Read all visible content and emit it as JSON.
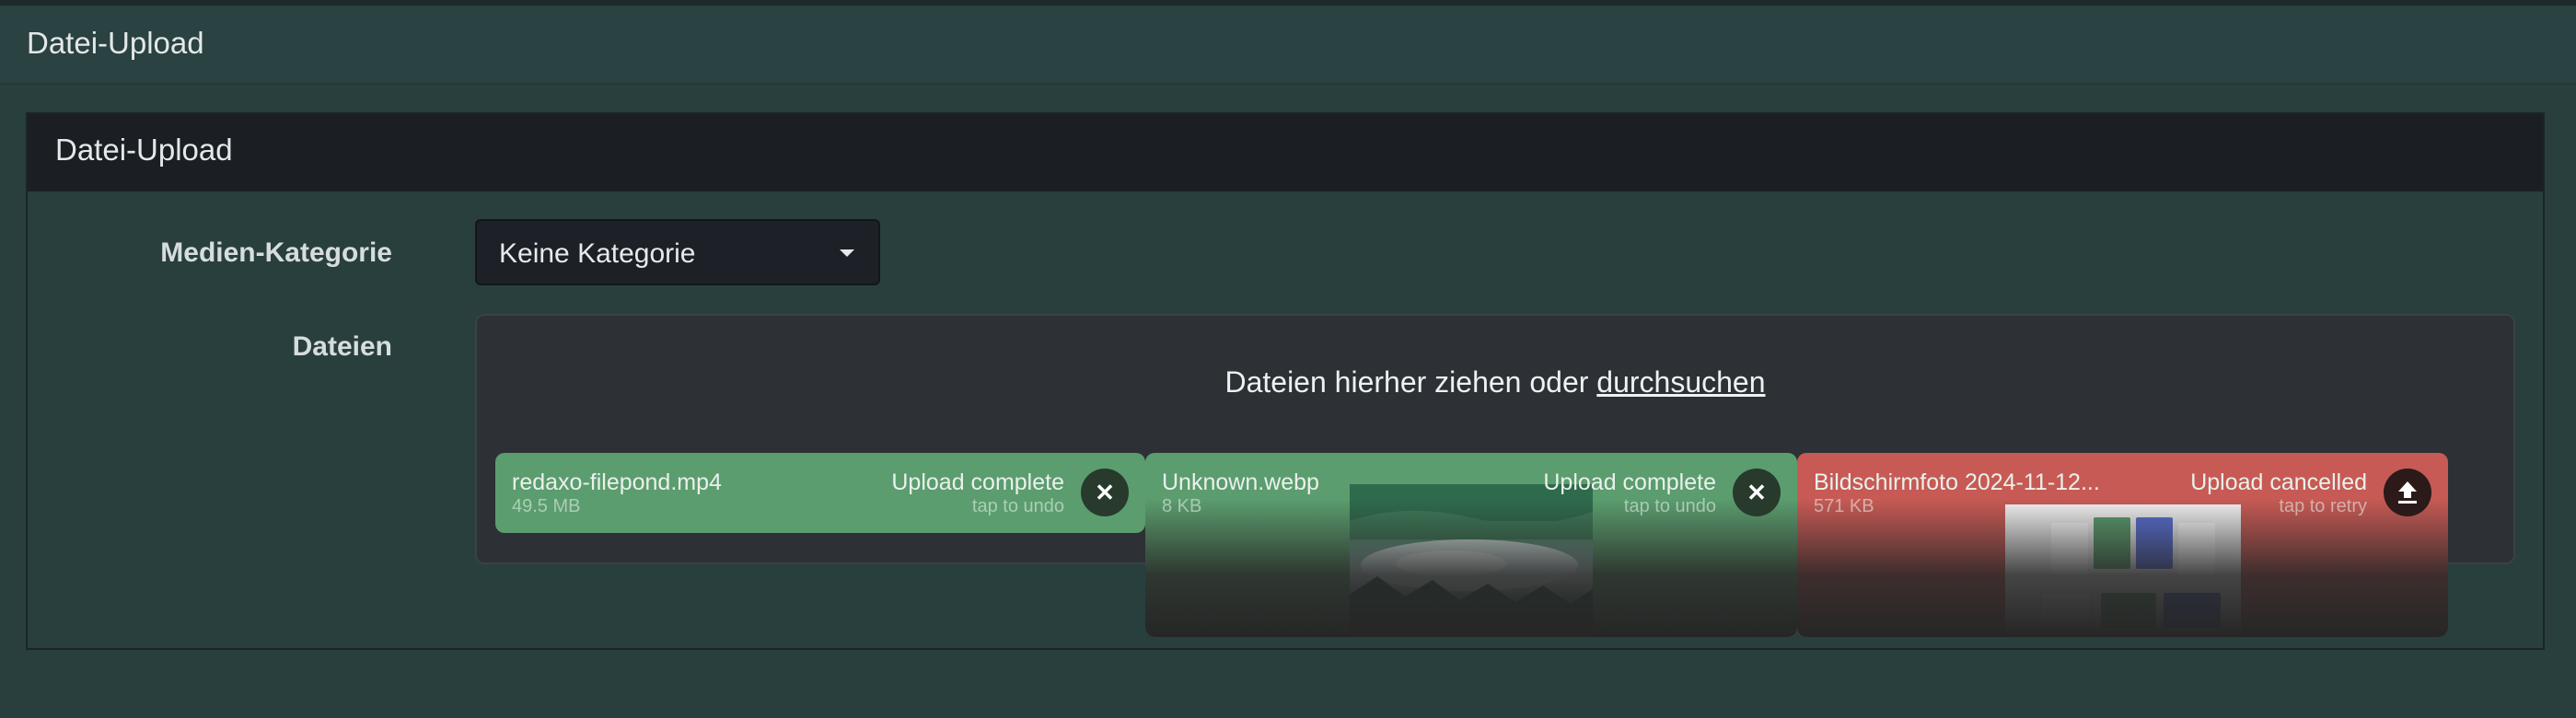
{
  "page": {
    "title": "Datei-Upload"
  },
  "panel": {
    "title": "Datei-Upload"
  },
  "form": {
    "category_label": "Medien-Kategorie",
    "category_value": "Keine Kategorie",
    "files_label": "Dateien"
  },
  "dropzone": {
    "text": "Dateien hierher ziehen oder",
    "link": "durchsuchen"
  },
  "files": [
    {
      "name": "redaxo-filepond.mp4",
      "size": "49.5 MB",
      "status": "Upload complete",
      "hint": "tap to undo",
      "action_icon": "close-icon",
      "color": "#5b9d6e"
    },
    {
      "name": "Unknown.webp",
      "size": "8 KB",
      "status": "Upload complete",
      "hint": "tap to undo",
      "action_icon": "close-icon",
      "color": "#5b9d6e"
    },
    {
      "name": "Bildschirmfoto 2024-11-12...",
      "size": "571 KB",
      "status": "Upload cancelled",
      "hint": "tap to retry",
      "action_icon": "upload-icon",
      "color": "#c75a54"
    }
  ]
}
